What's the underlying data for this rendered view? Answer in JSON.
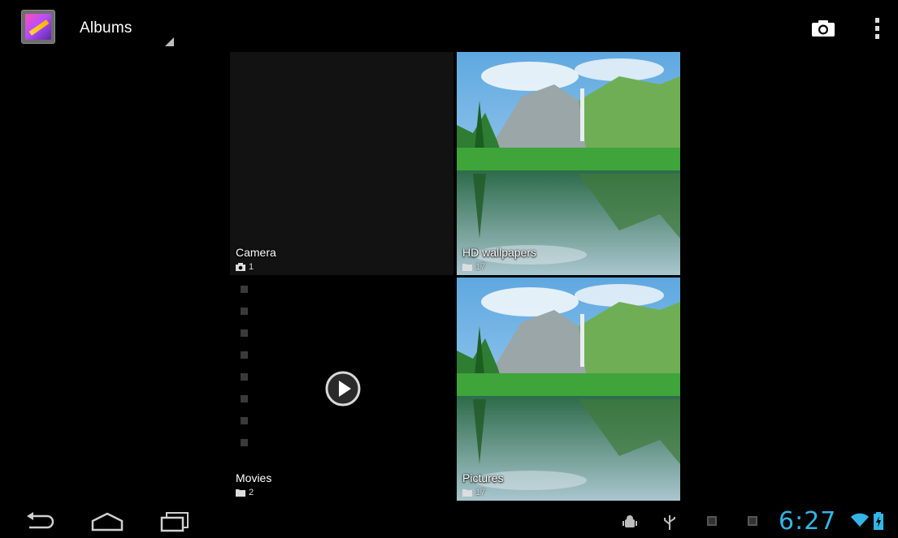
{
  "action_bar": {
    "title": "Albums",
    "app_icon": "gallery-icon",
    "actions": [
      "camera-icon",
      "overflow-menu-icon"
    ]
  },
  "albums": [
    {
      "name": "Camera",
      "count": "1",
      "count_icon": "camera-icon"
    },
    {
      "name": "HD wallpapers",
      "count": "17",
      "count_icon": "folder-icon"
    },
    {
      "name": "Movies",
      "count": "2",
      "count_icon": "folder-icon"
    },
    {
      "name": "Pictures",
      "count": "17",
      "count_icon": "folder-icon"
    }
  ],
  "navigation": [
    "back-icon",
    "home-icon",
    "recent-apps-icon"
  ],
  "status_bar": {
    "time": "6:27",
    "icons": [
      "android-debug-icon",
      "usb-icon",
      "notification-icon",
      "notification-icon",
      "wifi-icon",
      "battery-charging-icon"
    ],
    "accent_color": "#33b5e5"
  }
}
